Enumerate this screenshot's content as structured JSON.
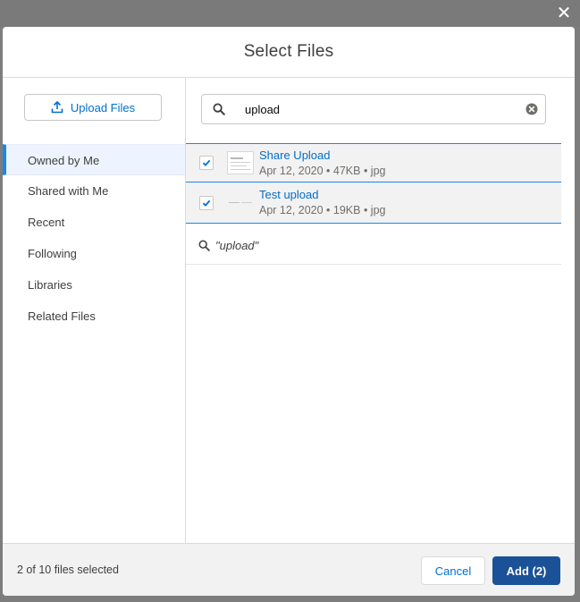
{
  "modal": {
    "title": "Select Files",
    "close_icon": "close-icon"
  },
  "sidebar": {
    "upload_button_label": "Upload Files",
    "upload_icon": "upload-icon",
    "items": [
      {
        "label": "Owned by Me",
        "active": true
      },
      {
        "label": "Shared with Me",
        "active": false
      },
      {
        "label": "Recent",
        "active": false
      },
      {
        "label": "Following",
        "active": false
      },
      {
        "label": "Libraries",
        "active": false
      },
      {
        "label": "Related Files",
        "active": false
      }
    ]
  },
  "search": {
    "value": "upload",
    "search_icon": "search-icon",
    "clear_icon": "clear-icon"
  },
  "files": [
    {
      "name": "Share Upload",
      "meta": "Apr 12, 2020 • 47KB • jpg",
      "checked": true
    },
    {
      "name": "Test upload",
      "meta": "Apr 12, 2020 • 19KB • jpg",
      "checked": true
    }
  ],
  "search_hint": {
    "text": "\"upload\""
  },
  "footer": {
    "selected_count": "2 of 10 files selected",
    "cancel_label": "Cancel",
    "add_label": "Add (2)"
  },
  "colors": {
    "brand_blue": "#1b5297",
    "link_blue": "#0070d2",
    "selection_border": "#1589ee"
  }
}
